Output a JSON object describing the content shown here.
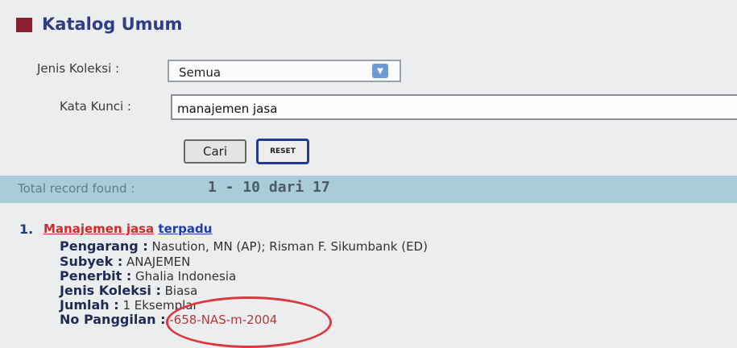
{
  "header": {
    "title": "Katalog Umum"
  },
  "form": {
    "jenis_label": "Jenis Koleksi :",
    "jenis_value": "Semua",
    "kata_label": "Kata Kunci :",
    "kata_value": "manajemen jasa",
    "cari_label": "Cari",
    "reset_label": "RESET"
  },
  "results": {
    "total_label": "Total record found :",
    "range": "1 - 10 dari 17"
  },
  "item": {
    "number": "1.",
    "title_part1": "Manajemen jasa",
    "title_part2": "terpadu",
    "pengarang_label": "Pengarang :",
    "pengarang_value": "Nasution, MN (AP); Risman F. Sikumbank (ED)",
    "subyek_label": "Subyek :",
    "subyek_value": "ANAJEMEN",
    "penerbit_label": "Penerbit :",
    "penerbit_value": "Ghalia Indonesia",
    "jenis_label": "Jenis Koleksi :",
    "jenis_value": "Biasa",
    "jumlah_label": "Jumlah :",
    "jumlah_value": "1 Eksemplar",
    "panggilan_label": "No Panggilan :",
    "panggilan_value": "-658-NAS-m-2004"
  },
  "colors": {
    "title_square": "#8a1f32",
    "title_text": "#2e3d86",
    "results_bar": "#a9ccd8",
    "link_red": "#d02a2a",
    "link_blue": "#1e3ea8",
    "annotation_circle": "#d9393f"
  },
  "icons": {
    "select_arrow": "chevron-down-icon"
  }
}
